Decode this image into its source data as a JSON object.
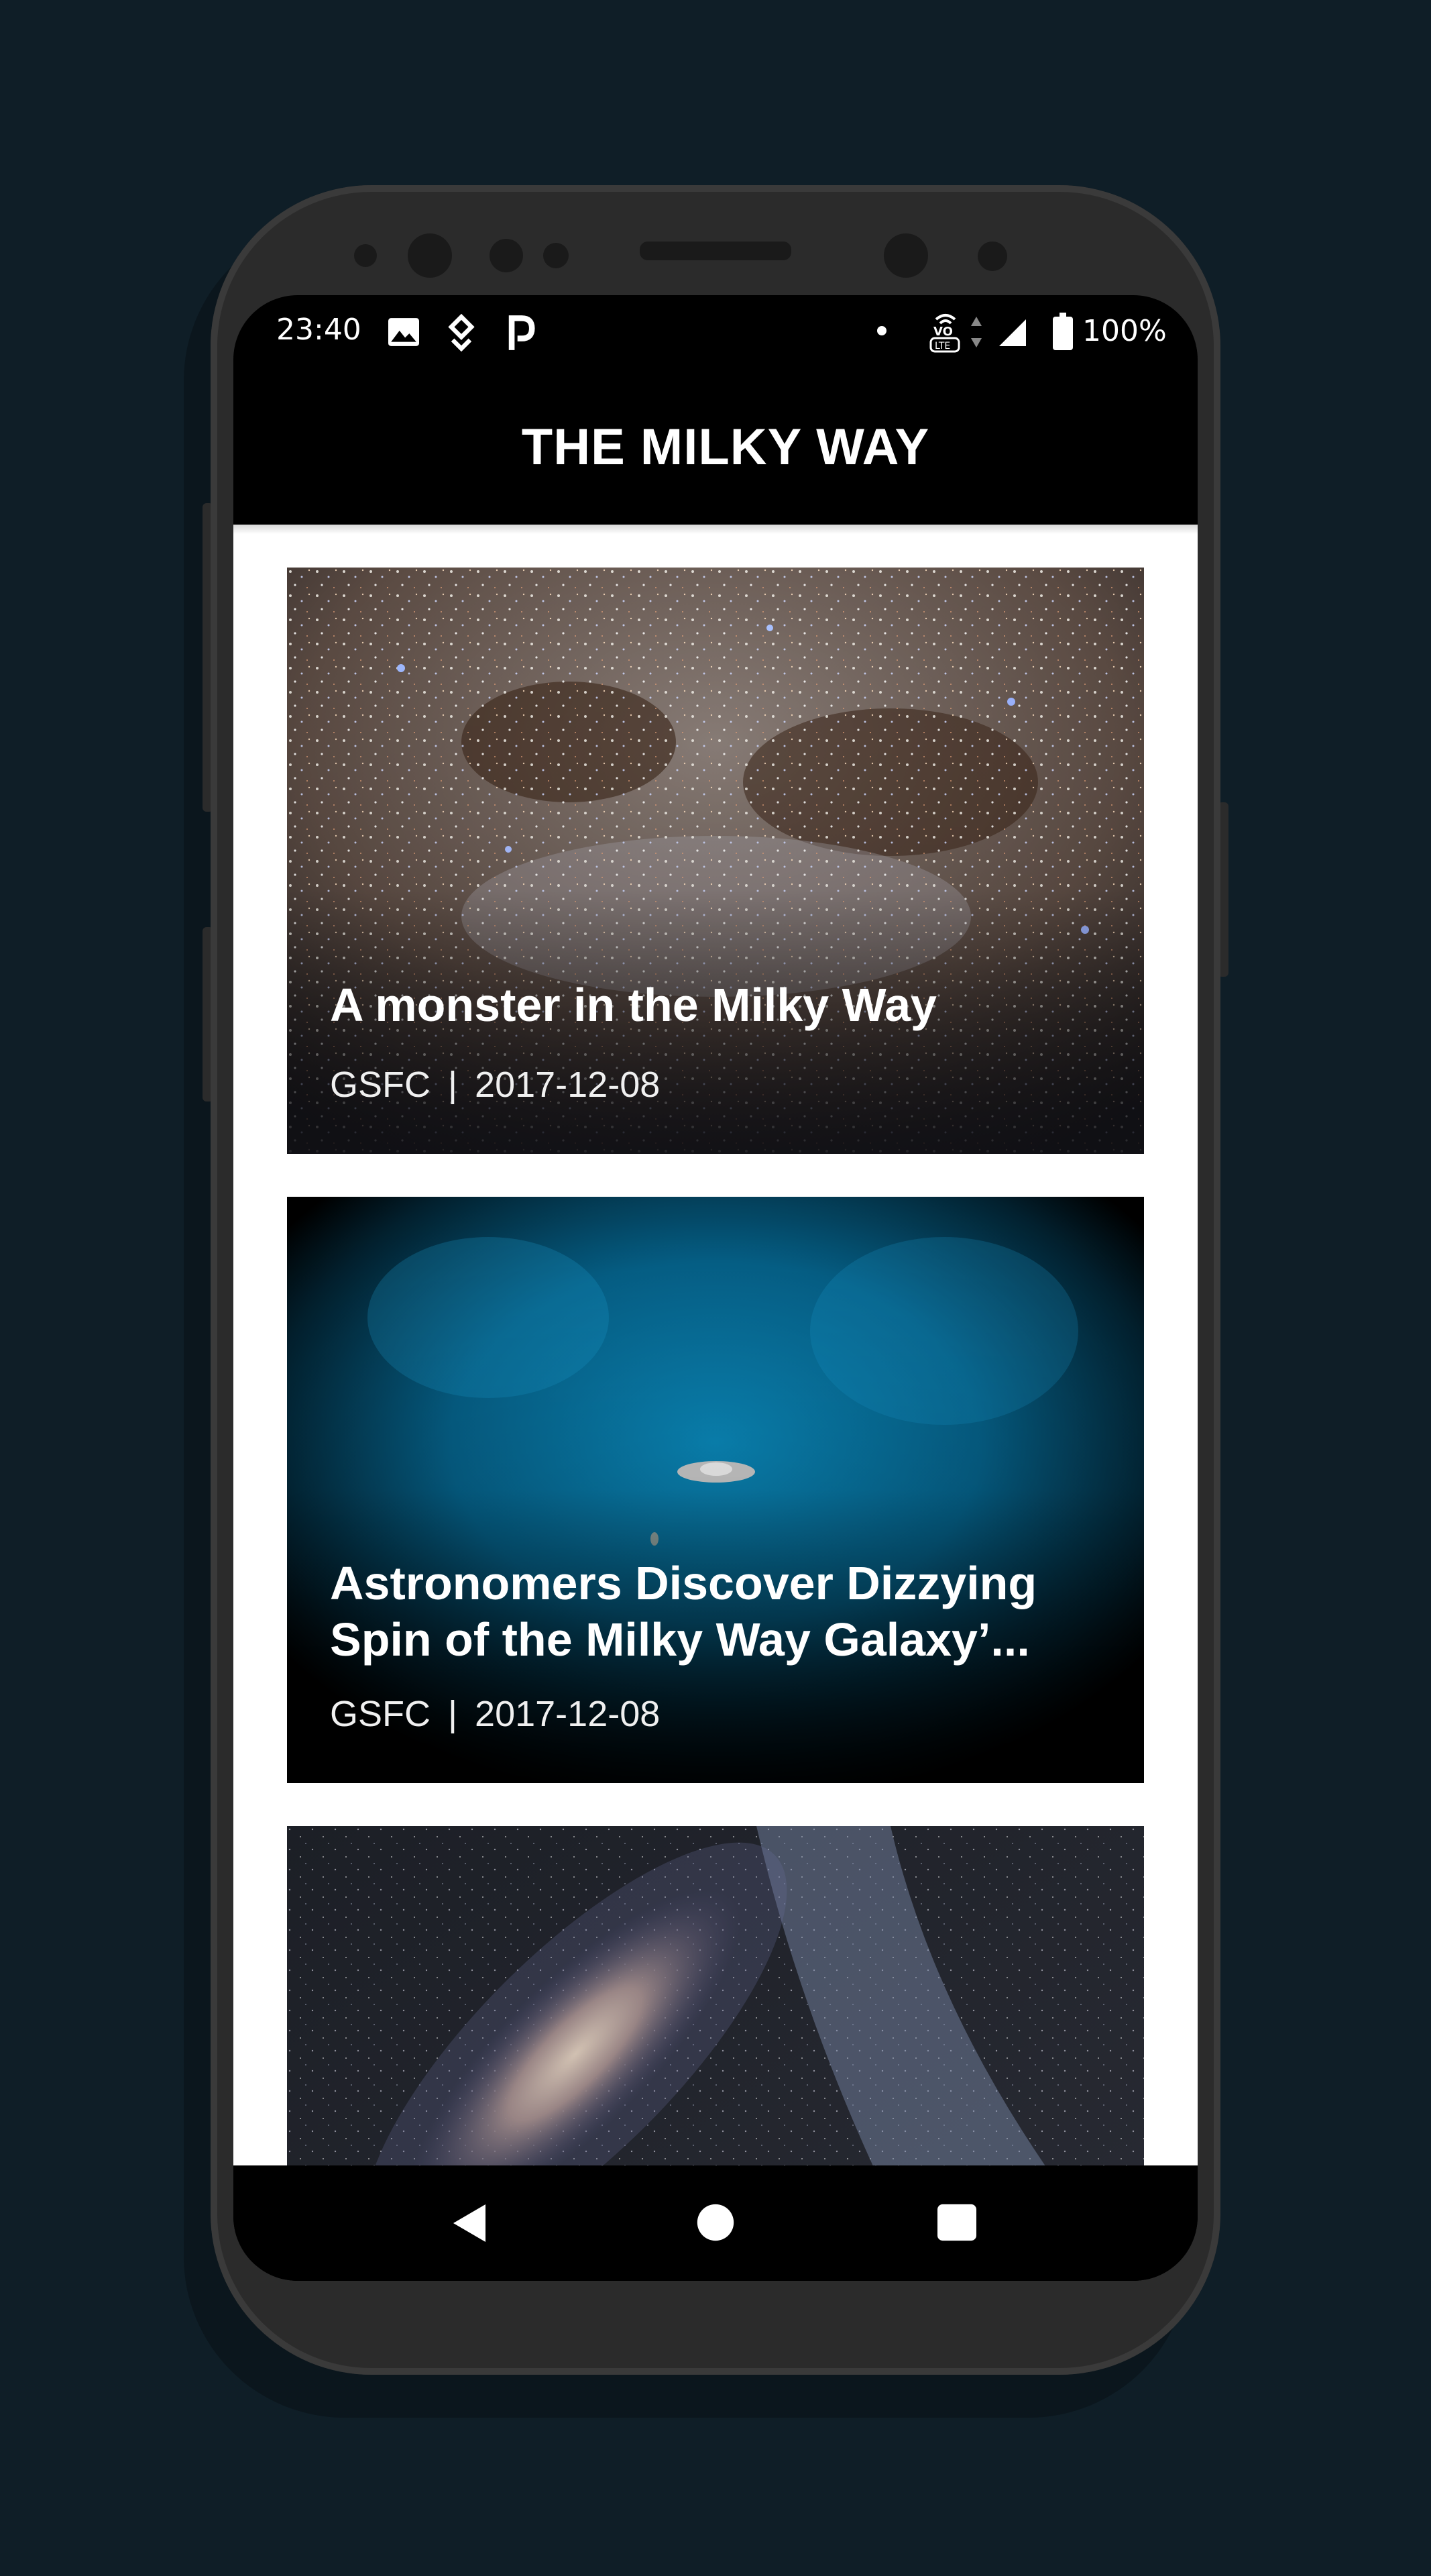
{
  "status_bar": {
    "time": "23:40",
    "battery": "100%",
    "left_icons": [
      "image-icon",
      "location-icon",
      "parking-icon"
    ],
    "right_icons": [
      "dot-icon",
      "volte-icon",
      "data-arrows-icon",
      "signal-icon",
      "battery-icon"
    ]
  },
  "app_bar": {
    "title": "THE MILKY WAY"
  },
  "articles": [
    {
      "title": "A monster in the Milky Way",
      "source": "GSFC",
      "separator": "|",
      "date": "2017-12-08"
    },
    {
      "title": "Astronomers Discover Dizzying Spin of the Milky Way Galaxy’...",
      "source": "GSFC",
      "separator": "|",
      "date": "2017-12-08"
    },
    {
      "title": "",
      "source": "",
      "separator": "",
      "date": ""
    }
  ],
  "nav_bar": {
    "icons": [
      "back-icon",
      "home-icon",
      "recents-icon"
    ]
  },
  "colors": {
    "background": "#0f1e27",
    "phone_body": "#2b2b2b",
    "app_bar": "#000000",
    "content_bg": "#ffffff"
  }
}
